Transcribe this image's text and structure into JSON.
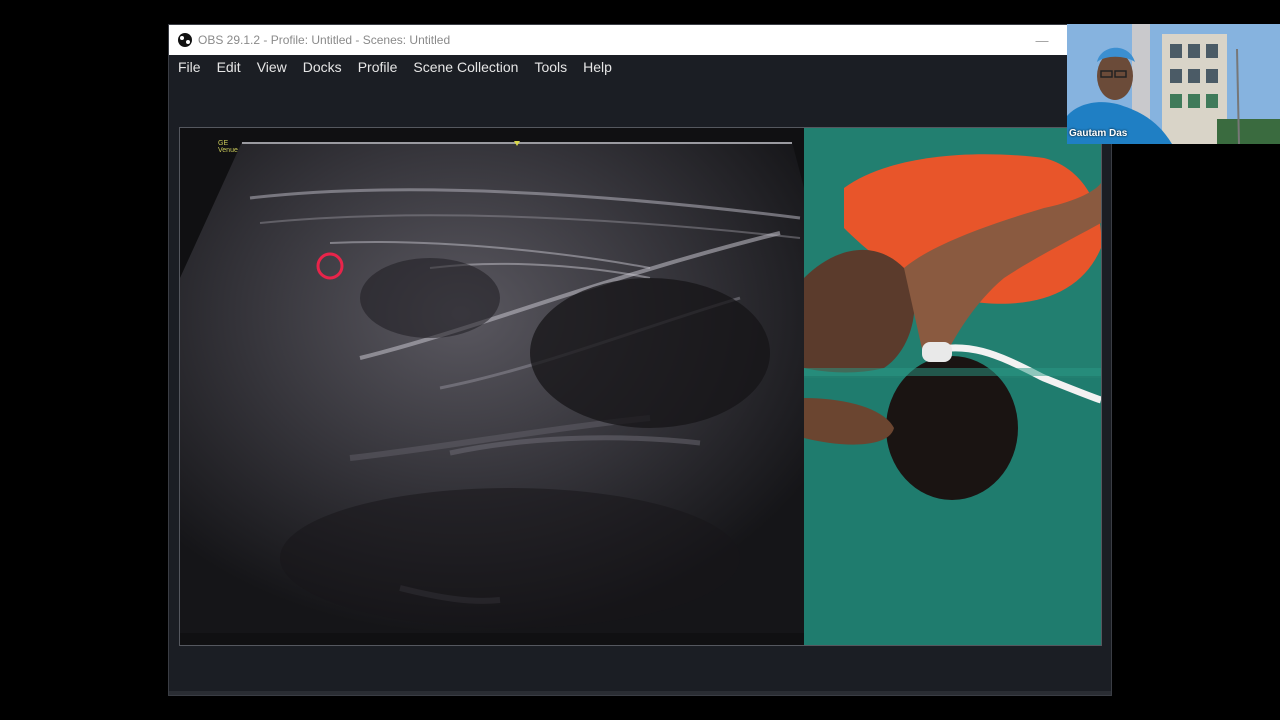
{
  "window": {
    "title": "OBS 29.1.2 - Profile: Untitled - Scenes: Untitled",
    "minimize_glyph": "—",
    "maximize_glyph": ""
  },
  "menu": [
    "File",
    "Edit",
    "View",
    "Docks",
    "Profile",
    "Scene Collection",
    "Tools",
    "Help"
  ],
  "ultrasound": {
    "probe_label_line1": "GE",
    "probe_label_line2": "Venue",
    "marker_color": "#e8244a"
  },
  "participant": {
    "name": "Gautam Das"
  },
  "colors": {
    "drape": "#1f7c6e",
    "patient_shirt": "#e8552a",
    "titlebar": "#ffffff",
    "obs_background": "#1b1e24"
  },
  "icons": {
    "app": "obs-logo-icon",
    "minimize": "minimize-icon",
    "maximize": "maximize-icon"
  }
}
